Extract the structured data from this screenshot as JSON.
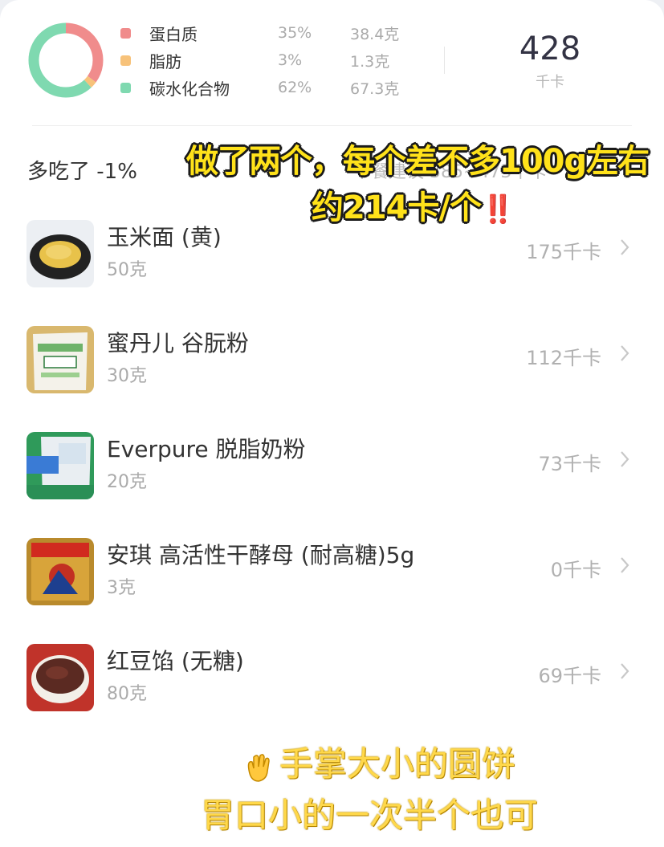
{
  "summary": {
    "macros": [
      {
        "name": "蛋白质",
        "pct": "35%",
        "grams": "38.4克",
        "color": "#f08c8c"
      },
      {
        "name": "脂肪",
        "pct": "3%",
        "grams": "1.3克",
        "color": "#f7c27a"
      },
      {
        "name": "碳水化合物",
        "pct": "62%",
        "grams": "67.3克",
        "color": "#7fd9b0"
      }
    ],
    "kcal_value": "428",
    "kcal_unit": "千卡"
  },
  "status": {
    "over_text": "多吃了 -1%",
    "suggest_text": "午餐建议 385~473千卡"
  },
  "foods": [
    {
      "name": "玉米面 (黄)",
      "amount": "50克",
      "kcal": "175千卡",
      "image_icon": "cornmeal-image"
    },
    {
      "name": "蜜丹儿 谷朊粉",
      "amount": "30克",
      "kcal": "112千卡",
      "image_icon": "gluten-powder-image"
    },
    {
      "name": "Everpure 脱脂奶粉",
      "amount": "20克",
      "kcal": "73千卡",
      "image_icon": "skim-milk-powder-image"
    },
    {
      "name": "安琪 高活性干酵母 (耐高糖)5g",
      "amount": "3克",
      "kcal": "0千卡",
      "image_icon": "yeast-packet-image"
    },
    {
      "name": "红豆馅 (无糖)",
      "amount": "80克",
      "kcal": "69千卡",
      "image_icon": "red-bean-paste-image"
    }
  ],
  "overlay": {
    "caption1": "做了两个，每个差不多100g左右",
    "caption2": "约214卡/个",
    "caption2_mark": "‼️",
    "handwritten1": "手掌大小的圆饼",
    "handwritten2": "胃口小的一次半个也可"
  }
}
